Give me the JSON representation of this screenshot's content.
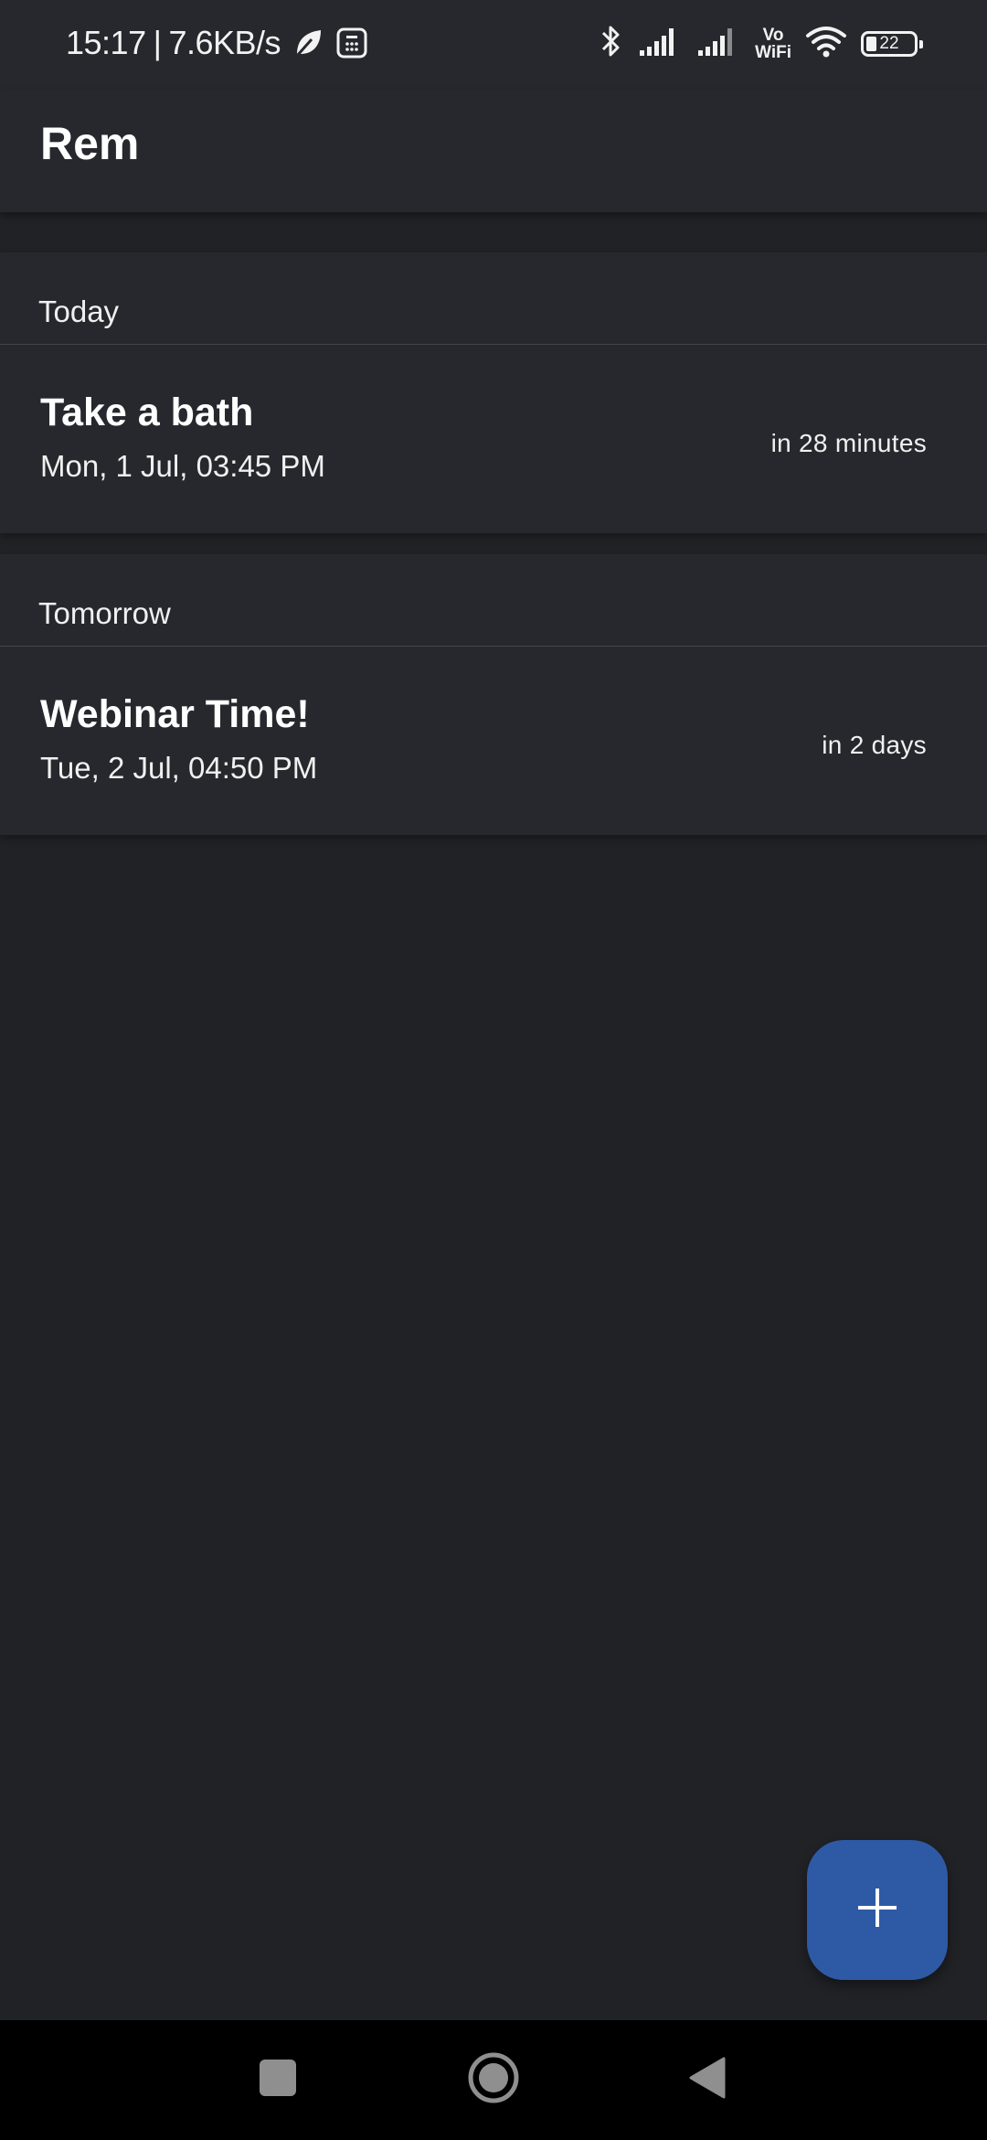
{
  "status_bar": {
    "time": "15:17",
    "separator": "|",
    "network_speed": "7.6KB/s",
    "vowifi_top": "Vo",
    "vowifi_bottom": "WiFi",
    "battery_level": "22"
  },
  "app_bar": {
    "title": "Rem"
  },
  "sections": [
    {
      "header": "Today",
      "reminders": [
        {
          "title": "Take a bath",
          "date": "Mon, 1 Jul, 03:45 PM",
          "relative": "in 28 minutes"
        }
      ]
    },
    {
      "header": "Tomorrow",
      "reminders": [
        {
          "title": "Webinar Time!",
          "date": "Tue, 2 Jul, 04:50 PM",
          "relative": "in 2 days"
        }
      ]
    }
  ],
  "fab": {
    "icon": "plus-icon"
  },
  "nav_bar": {
    "icons": [
      "square-recents-icon",
      "circle-home-icon",
      "triangle-back-icon"
    ]
  },
  "colors": {
    "background": "#212226",
    "surface": "#27282d",
    "accent": "#2e5aa5",
    "divider": "#45464b"
  }
}
